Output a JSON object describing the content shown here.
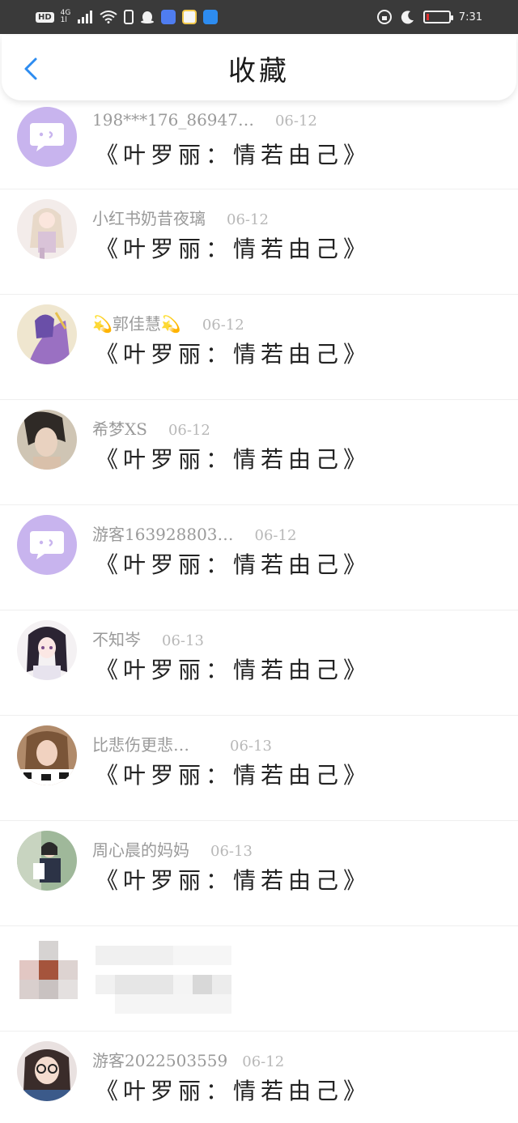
{
  "status_bar": {
    "hd": "HD",
    "network_top": "4G",
    "network_bottom": "1l",
    "time": "7:31",
    "battery_level": 0.12
  },
  "header": {
    "title": "收藏"
  },
  "items": [
    {
      "name": "198***176_86947…",
      "date": "06-12",
      "book": "《叶罗丽：情若由己》",
      "avatar": "bubble-icon"
    },
    {
      "name": "小红书奶昔夜璃",
      "date": "06-12",
      "book": "《叶罗丽：情若由己》",
      "avatar": "anime-girl-avatar"
    },
    {
      "name": "💫郭佳慧💫",
      "date": "06-12",
      "book": "《叶罗丽：情若由己》",
      "avatar": "purple-fairy-avatar"
    },
    {
      "name": "希梦XS",
      "date": "06-12",
      "book": "《叶罗丽：情若由己》",
      "avatar": "portrait-avatar"
    },
    {
      "name": "游客163928803…",
      "date": "06-12",
      "book": "《叶罗丽：情若由己》",
      "avatar": "bubble-icon"
    },
    {
      "name": "不知岑",
      "date": "06-13",
      "book": "《叶罗丽：情若由己》",
      "avatar": "anime-dark-hair-avatar"
    },
    {
      "name": "比悲伤更悲…",
      "date": "06-13",
      "book": "《叶罗丽：情若由己》",
      "avatar": "photo-girl-avatar"
    },
    {
      "name": "周心晨的妈妈",
      "date": "06-13",
      "book": "《叶罗丽：情若由己》",
      "avatar": "school-uniform-avatar"
    },
    {
      "name": "",
      "date": "",
      "book": "",
      "avatar": "blurred"
    },
    {
      "name": "游客2022503559",
      "date": "06-12",
      "book": "《叶罗丽：情若由己》",
      "avatar": "glasses-girl-avatar"
    }
  ],
  "colors": {
    "accent_blue": "#2d8cf0",
    "bubble_purple": "#c8b4ee",
    "statusbar_bg": "#3a3a3a"
  }
}
